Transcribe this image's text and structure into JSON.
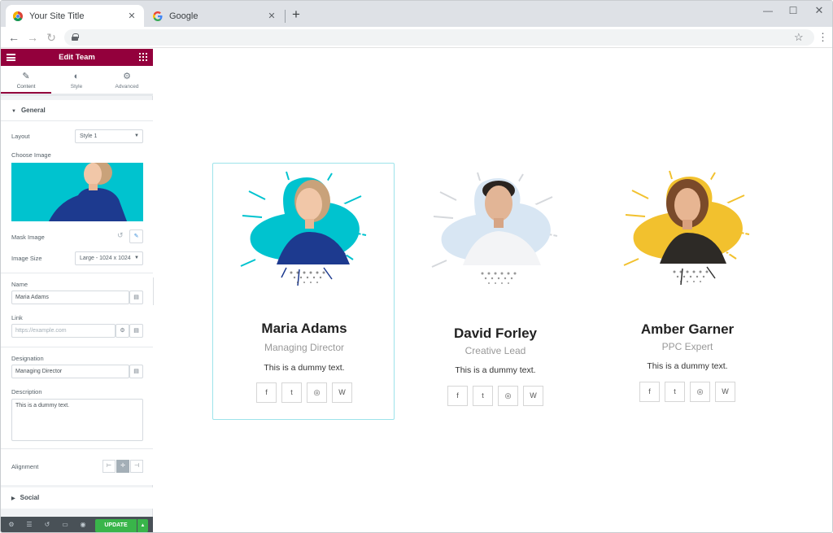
{
  "browser": {
    "tabs": [
      {
        "title": "Your Site Title",
        "active": true
      },
      {
        "title": "Google",
        "active": false
      }
    ],
    "new_tab": "+",
    "tab_close": "✕",
    "window_controls": {
      "minimize": "—",
      "maximize": "☐",
      "close": "✕"
    },
    "nav": {
      "back": "←",
      "forward": "→",
      "reload": "↻"
    },
    "bookmark_icon": "☆",
    "menu_icon": "⋮"
  },
  "editor": {
    "title": "Edit Team",
    "tabs": [
      {
        "label": "Content",
        "icon": "✎"
      },
      {
        "label": "Style",
        "icon": "◐"
      },
      {
        "label": "Advanced",
        "icon": "⚙"
      }
    ],
    "general_section": "General",
    "layout_label": "Layout",
    "layout_value": "Style 1",
    "choose_image_label": "Choose Image",
    "mask_image_label": "Mask Image",
    "image_size_label": "Image Size",
    "image_size_value": "Large - 1024 x 1024",
    "name_label": "Name",
    "name_value": "Maria Adams",
    "link_label": "Link",
    "link_placeholder": "https://example.com",
    "designation_label": "Designation",
    "designation_value": "Managing Director",
    "description_label": "Description",
    "description_value": "This is a dummy text.",
    "alignment_label": "Alignment",
    "social_section": "Social",
    "update_label": "UPDATE"
  },
  "team": [
    {
      "name": "Maria Adams",
      "designation": "Managing Director",
      "description": "This is a dummy text.",
      "blob_color": "#00c3cf",
      "selected": true
    },
    {
      "name": "David Forley",
      "designation": "Creative Lead",
      "description": "This is a dummy text.",
      "blob_color": "#d8e6f3",
      "selected": false
    },
    {
      "name": "Amber Garner",
      "designation": "PPC Expert",
      "description": "This is a dummy text.",
      "blob_color": "#f2c12e",
      "selected": false
    }
  ],
  "social_icons": [
    "f",
    "t",
    "◎",
    "W"
  ],
  "colors": {
    "accent": "#93003c",
    "update": "#39b54a",
    "selection": "#9de3ea"
  }
}
